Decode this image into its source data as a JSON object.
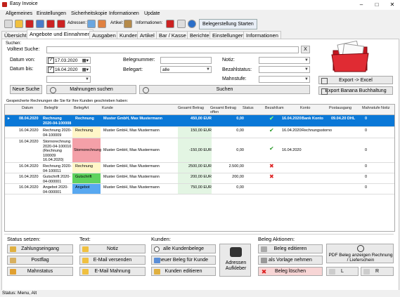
{
  "window": {
    "title": "Easy Invoice"
  },
  "menu": [
    "Allgemeines",
    "Einstellungen",
    "Sicherheitskopie",
    "Informationen",
    "Update"
  ],
  "toolbar": {
    "adressen_label": "Adressen:",
    "artikel_label": "Artikel:",
    "informationen_label": "Informationen:",
    "beleg_button": "Belegerstellung Starten"
  },
  "tabs": [
    "Übersicht",
    "Angebote und Einnahmen",
    "Ausgaben",
    "Kunden",
    "Artikel",
    "Bar / Kasse",
    "Berichte",
    "Einstellungen",
    "Informationen"
  ],
  "search": {
    "section_label": "Suchen:",
    "volltext_label": "Volltext Suche:",
    "volltext_value": "",
    "clear_button": "X",
    "datum_von_label": "Datum von:",
    "datum_von_value": "17.03.2020",
    "datum_bis_label": "Datum bis:",
    "datum_bis_value": "16.04.2020",
    "belegnummer_label": "Belegnummer:",
    "belegnummer_value": "",
    "belegart_label": "Belegart:",
    "belegart_value": "alle",
    "notiz_label": "Notiz:",
    "bezahlstatus_label": "Bezahlstatus:",
    "mahnstufe_label": "Mahnstufe:",
    "neue_suche": "Neue Suche",
    "mahnungen_suchen": "Mahnungen suchen",
    "suchen": "Suchen",
    "export_excel": "Export -> Excel",
    "export_banana": "Export Banana Buchhaltung"
  },
  "grid": {
    "caption": "Gespeicherte Rechnungen die Sie für Ihre Kunden geschrieben haben:",
    "headers": [
      "Datum",
      "BelegNr",
      "BelegArt",
      "Kunde",
      "Gesamt Betrag",
      "Gesamt Betrag offen",
      "Status",
      "Bezahlt",
      "am",
      "Konto",
      "Postausgang",
      "Mahnstufe",
      "Notiz"
    ],
    "rows": [
      {
        "datum": "08.04.2020",
        "belegnr": "Rechnung 2020-04-100008",
        "art": "Rechnung",
        "kunde": "Muster GmbH, Max Mustermann",
        "betrag": "450,00 EUR",
        "offen": "0,00",
        "bezahlt": "check",
        "am": "16.04.2020",
        "konto": "Bank Konto",
        "post": "09.04.20 DHL",
        "mahn": "0"
      },
      {
        "datum": "16.04.2020",
        "belegnr": "Rechnung 2020-04-100009",
        "art": "Rechnung",
        "kunde": "Muster GmbH, Max Mustermann",
        "betrag": "150,00 EUR",
        "offen": "0,00",
        "bezahlt": "check",
        "am": "16.04.2020",
        "konto": "Rechnungsstorno",
        "post": "",
        "mahn": "0"
      },
      {
        "datum": "16.04.2020",
        "belegnr": "Stornorechnung 2020-04-100010 (Rechnung 100009 16.04.2020)",
        "art": "Stornorechnung",
        "kunde": "Muster GmbH, Max Mustermann",
        "betrag": "-150,00 EUR",
        "offen": "0,00",
        "bezahlt": "check",
        "am": "16.04.2020",
        "konto": "",
        "post": "",
        "mahn": "0"
      },
      {
        "datum": "16.04.2020",
        "belegnr": "Rechnung 2020-04-100011",
        "art": "Rechnung",
        "kunde": "Muster GmbH, Max Mustermann",
        "betrag": "2500,00 EUR",
        "offen": "2.500,00",
        "bezahlt": "cross",
        "am": "",
        "konto": "",
        "post": "",
        "mahn": "0"
      },
      {
        "datum": "16.04.2020",
        "belegnr": "Gutschrift 2020-04-000001",
        "art": "Gutschrift",
        "kunde": "Muster GmbH, Max Mustermann",
        "betrag": "200,00 EUR",
        "offen": "200,00",
        "bezahlt": "cross",
        "am": "",
        "konto": "",
        "post": "",
        "mahn": "0"
      },
      {
        "datum": "16.04.2020",
        "belegnr": "Angebot 2020-04-000001",
        "art": "Angebot",
        "kunde": "Muster GmbH, Max Mustermann",
        "betrag": "750,00 EUR",
        "offen": "0,00",
        "bezahlt": "",
        "am": "",
        "konto": "",
        "post": "",
        "mahn": "0"
      }
    ]
  },
  "groups": {
    "status": {
      "title": "Status setzen:",
      "buttons": [
        "Zahlungseingang",
        "Postflag",
        "Mahnstatus"
      ]
    },
    "text": {
      "title": "Text:",
      "buttons": [
        "Notiz",
        "E-Mail versenden",
        "E-Mail Mahnung"
      ]
    },
    "kunden": {
      "title": "Kunden:",
      "buttons": [
        "alle Kundenbelege",
        "neuer Beleg für Kunde",
        "Kunden editieren"
      ],
      "adressen_aufkleber": "Adressen Aufkleber"
    },
    "beleg": {
      "title": "Beleg Aktionen:",
      "buttons": [
        "Beleg editieren",
        "als Vorlage nehmen",
        "Beleg löschen"
      ],
      "pdf": "PDF Beleg anzeigen Rechnung / Lieferschein",
      "l": "L",
      "r": "R"
    }
  },
  "status_bar": "Status: Menu, Alt",
  "colors": {
    "selection": "#0a78d7",
    "rechnung": "#fff6c8",
    "storno": "#f4a0a8",
    "gutschrift": "#5fd35f",
    "angebot": "#58a8f0",
    "betrag": "#e3f5e3"
  }
}
